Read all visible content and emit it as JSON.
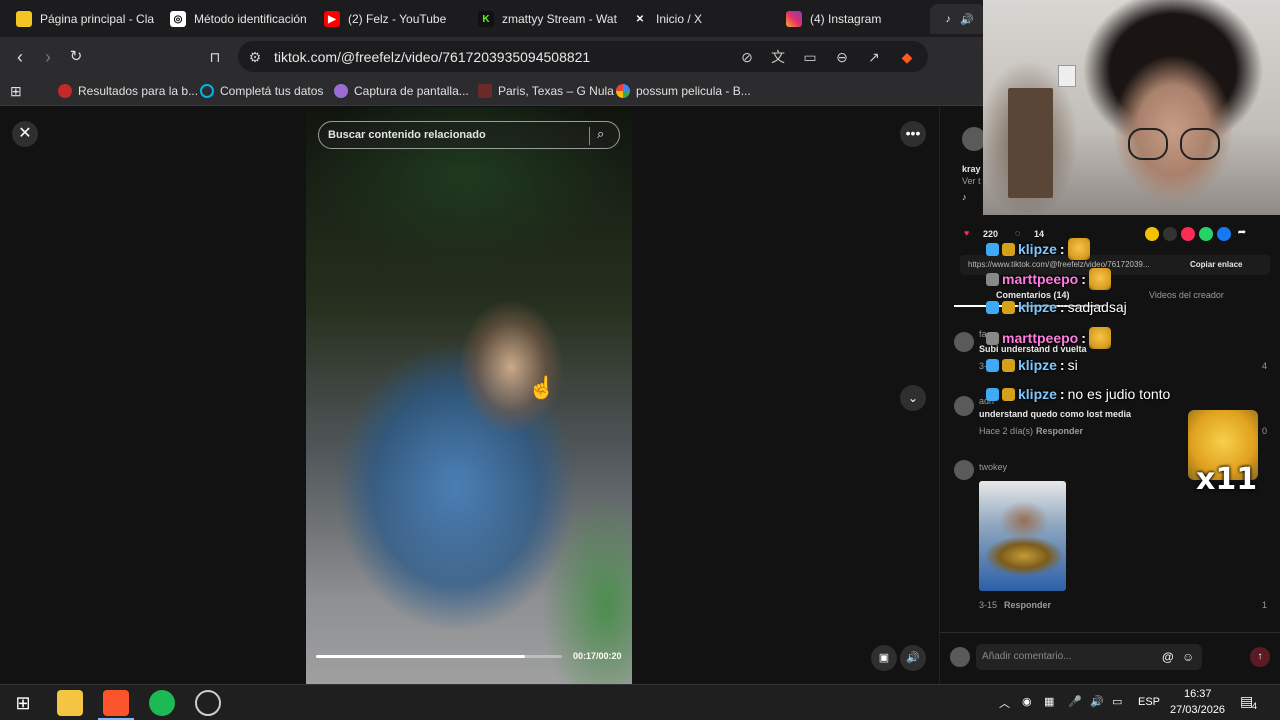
{
  "tabs": [
    {
      "title": "Página principal - Cla",
      "favicon_color": "#f3c623"
    },
    {
      "title": "Método identificación",
      "favicon_color": "#ffffff"
    },
    {
      "title": "(2) Felz - YouTube",
      "favicon_color": "#ff0000"
    },
    {
      "title": "zmattyy Stream - Wat",
      "favicon_color": "#53fc18"
    },
    {
      "title": "Inicio / X",
      "favicon_color": "#000000"
    },
    {
      "title": "(4) Instagram",
      "favicon_color": "#e1306c"
    }
  ],
  "address": {
    "url": "tiktok.com/@freefelz/video/7617203935094508821"
  },
  "bookmarks": [
    {
      "label": "Resultados para la b...",
      "color": "#c62828"
    },
    {
      "label": "Completá tus datos",
      "color": "#00b4e6"
    },
    {
      "label": "Captura de pantalla...",
      "color": "#9c6cd4"
    },
    {
      "label": "Paris, Texas – G Nula",
      "color": "#6b2a2a"
    },
    {
      "label": "possum pelicula - B...",
      "color": "#4285f4"
    }
  ],
  "video": {
    "search_placeholder": "Buscar contenido relacionado",
    "timecode": "00:17/00:20",
    "progress": 0.85
  },
  "panel": {
    "author_name": "kray",
    "author_sub": "Ver t",
    "likes": "220",
    "comments_count": "14",
    "link_text": "https://www.tiktok.com/@freefelz/video/76172039...",
    "copy_link": "Copiar enlace",
    "tab_comments": "Comentarios (14)",
    "tab_creator": "Videos del creador",
    "comments": [
      {
        "user": "fa",
        "text": "Subi understand d vuelta",
        "meta": "3-1",
        "likes": "4"
      },
      {
        "user": "adri",
        "text": "understand quedo como lost media",
        "meta": "Hace 2 día(s)",
        "reply": "Responder",
        "likes": "0"
      },
      {
        "user": "twokey",
        "meta": "3-15",
        "reply": "Responder",
        "likes": "1"
      }
    ],
    "add_comment_placeholder": "Añadir comentario..."
  },
  "chat": [
    {
      "user": "klipze",
      "color": "#7ec8ff",
      "text": ""
    },
    {
      "user": "marttpeepo",
      "color": "#ff7ce0",
      "text": ""
    },
    {
      "user": "klipze",
      "color": "#7ec8ff",
      "text": "sadjadsaj"
    },
    {
      "user": "marttpeepo",
      "color": "#ff7ce0",
      "text": ""
    },
    {
      "user": "klipze",
      "color": "#7ec8ff",
      "text": "si"
    },
    {
      "user": "klipze",
      "color": "#7ec8ff",
      "text": "no es judio tonto"
    }
  ],
  "chat_emote_count": "x11",
  "taskbar": {
    "lang": "ESP",
    "time": "16:37",
    "date": "27/03/2026",
    "notifications": "4"
  }
}
